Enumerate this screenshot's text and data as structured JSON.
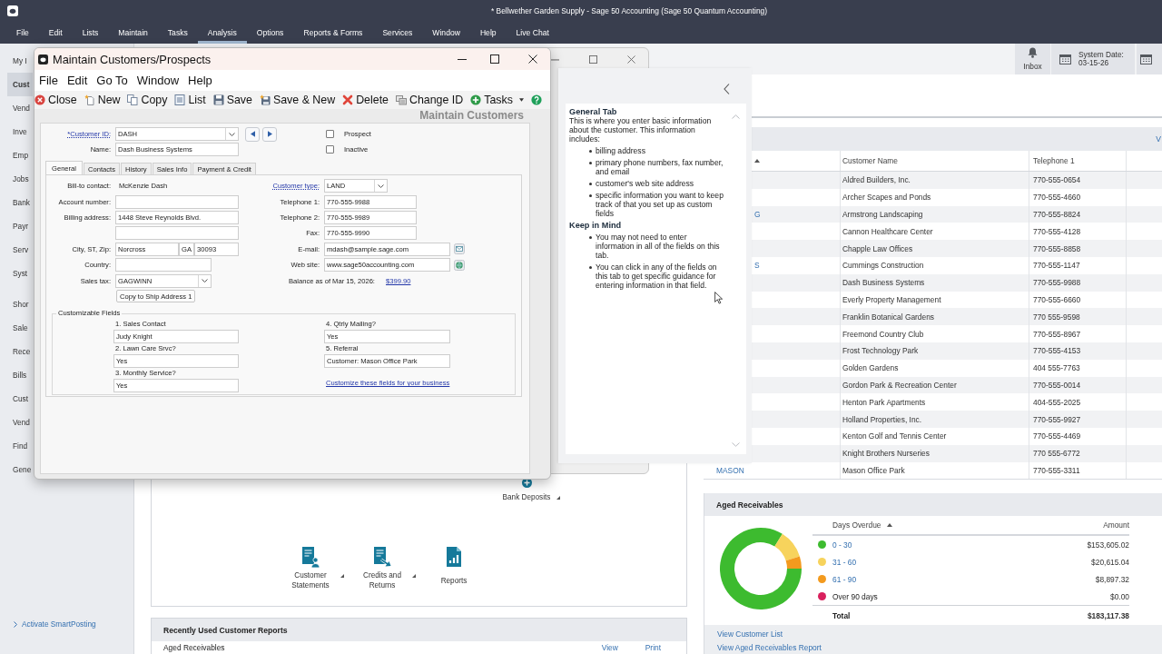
{
  "window": {
    "title": "* Bellwether Garden Supply - Sage 50 Accounting (Sage 50 Quantum Accounting)"
  },
  "menu": [
    {
      "label": "File",
      "selected": false
    },
    {
      "label": "Edit",
      "selected": false
    },
    {
      "label": "Lists",
      "selected": false
    },
    {
      "label": "Maintain",
      "selected": false
    },
    {
      "label": "Tasks",
      "selected": false
    },
    {
      "label": "Analysis",
      "selected": true
    },
    {
      "label": "Options",
      "selected": false
    },
    {
      "label": "Reports & Forms",
      "selected": false
    },
    {
      "label": "Services",
      "selected": false
    },
    {
      "label": "Window",
      "selected": false
    },
    {
      "label": "Help",
      "selected": false
    },
    {
      "label": "Live Chat",
      "selected": false
    }
  ],
  "sidebar": {
    "items": [
      {
        "label": "My I",
        "selected": false
      },
      {
        "label": "Cust",
        "selected": true
      },
      {
        "label": "Vend",
        "selected": false
      },
      {
        "label": "Inve",
        "selected": false
      },
      {
        "label": "Emp",
        "selected": false
      },
      {
        "label": "Jobs",
        "selected": false
      },
      {
        "label": "Bank",
        "selected": false
      },
      {
        "label": "Payr",
        "selected": false
      },
      {
        "label": "Serv",
        "selected": false
      },
      {
        "label": "Syst",
        "selected": false
      }
    ],
    "shortcuts_title": "Shor",
    "shortcuts": [
      "Sale",
      "Rece",
      "Bills",
      "Cust",
      "Vend",
      "Find",
      "Gene"
    ],
    "smartposting_link": "Activate SmartPosting"
  },
  "top_bar": {
    "inbox": "Inbox",
    "system_date_label": "System Date:",
    "system_date": "03-15-26"
  },
  "workflow": [
    {
      "kind": "deposit",
      "label": "Bank Deposits",
      "menu": true
    },
    {
      "kind": "statement",
      "label": "Customer Statements",
      "menu": true
    },
    {
      "kind": "credit",
      "label": "Credits and Returns",
      "menu": true
    },
    {
      "kind": "report",
      "label": "Reports",
      "menu": false
    }
  ],
  "recent_reports": {
    "title": "Recently Used Customer Reports",
    "rows": [
      {
        "name": "Aged Receivables",
        "actions": [
          "View",
          "Print"
        ]
      }
    ]
  },
  "customers": {
    "link": "V",
    "columns": [
      {
        "sorted": true,
        "cut": true
      },
      {
        "label": "Customer Name",
        "sorted": false
      },
      {
        "label": "Telephone 1",
        "sorted": false
      }
    ],
    "rows": [
      {
        "name": "Aldred Builders, Inc.",
        "phone": "770-555-0654"
      },
      {
        "name": "Archer Scapes and Ponds",
        "phone": "770-555-4660"
      },
      {
        "id": "G",
        "cut": true,
        "name": "Armstrong Landscaping",
        "phone": "770-555-8824"
      },
      {
        "name": "Cannon Healthcare Center",
        "phone": "770-555-4128"
      },
      {
        "name": "Chapple Law Offices",
        "phone": "770-555-8858"
      },
      {
        "id": "S",
        "cut": true,
        "name": "Cummings Construction",
        "phone": "770-555-1147"
      },
      {
        "name": "Dash Business Systems",
        "phone": "770-555-9988"
      },
      {
        "name": "Everly Property Management",
        "phone": "770-555-6660"
      },
      {
        "name": "Franklin Botanical Gardens",
        "phone": "770 555-9598"
      },
      {
        "name": "Freemond Country Club",
        "phone": "770-555-8967"
      },
      {
        "name": "Frost Technology Park",
        "phone": "770-555-4153"
      },
      {
        "name": "Golden Gardens",
        "phone": "404 555-7763"
      },
      {
        "name": "Gordon Park & Recreation Center",
        "phone": "770-555-0014"
      },
      {
        "name": "Henton Park Apartments",
        "phone": "404-555-2025"
      },
      {
        "name": "Holland Properties, Inc.",
        "phone": "770-555-9927"
      },
      {
        "name": "Kenton Golf and Tennis Center",
        "phone": "770-555-4469"
      },
      {
        "name": "Knight Brothers Nurseries",
        "phone": "770 555-6772"
      },
      {
        "id": "MASON",
        "name": "Mason Office Park",
        "phone": "770-555-3311"
      }
    ]
  },
  "aged_receivables": {
    "title": "Aged Receivables",
    "columns": [
      {
        "label": "Days Overdue",
        "sorted": true
      },
      {
        "label": "Amount",
        "sorted": false
      }
    ],
    "rows": [
      {
        "label": "0 - 30",
        "amount": "$153,605.02",
        "color": "#3dbb2f",
        "link": true
      },
      {
        "label": "31 - 60",
        "amount": "$20,615.04",
        "color": "#f7d35c",
        "link": true
      },
      {
        "label": "61 - 90",
        "amount": "$8,897.32",
        "color": "#f39a1e",
        "link": true
      },
      {
        "label": "Over 90 days",
        "amount": "$0.00",
        "color": "#d9205d",
        "link": false
      }
    ],
    "total": {
      "label": "Total",
      "amount": "$183,117.38"
    },
    "chart_data": {
      "type": "donut",
      "values": [
        83.88,
        11.26,
        4.86,
        0
      ]
    },
    "links": [
      "View Customer List",
      "View Aged Receivables Report"
    ]
  },
  "customer_dialog": {
    "title": "Maintain Customers/Prospects",
    "menu": [
      "File",
      "Edit",
      "Go To",
      "Window",
      "Help"
    ],
    "toolbar": [
      {
        "kind": "close",
        "label": "Close"
      },
      {
        "kind": "new",
        "label": "New"
      },
      {
        "kind": "copy",
        "label": "Copy"
      },
      {
        "kind": "list",
        "label": "List"
      },
      {
        "kind": "save",
        "label": "Save"
      },
      {
        "kind": "save-new",
        "label": "Save & New"
      },
      {
        "kind": "delete",
        "label": "Delete"
      },
      {
        "kind": "change-id",
        "label": "Change ID"
      },
      {
        "kind": "tasks",
        "label": "Tasks",
        "menu": true
      },
      {
        "kind": "help"
      }
    ],
    "heading": "Maintain Customers",
    "customer_id": {
      "label": "*Customer ID:",
      "link": true,
      "value": "DASH"
    },
    "name": {
      "label": "Name:",
      "value": "Dash Business Systems"
    },
    "checkboxes": [
      {
        "label": "Prospect",
        "checked": false
      },
      {
        "label": "Inactive",
        "checked": false
      }
    ],
    "tabs": [
      {
        "label": "General",
        "selected": true
      },
      {
        "label": "Contacts",
        "selected": false
      },
      {
        "label": "History",
        "selected": false
      },
      {
        "label": "Sales Info",
        "selected": false
      },
      {
        "label": "Payment & Credit",
        "selected": false
      }
    ],
    "general": {
      "left": [
        {
          "kind": "text",
          "label": "Bill-to contact:",
          "value": "McKenzie Dash"
        },
        {
          "kind": "input",
          "label": "Account number:"
        },
        {
          "kind": "input",
          "label": "Billing address:",
          "value": "1448 Steve Reynolds Blvd."
        },
        {
          "kind": "input"
        },
        {
          "kind": "city",
          "label": "City, ST, Zip:",
          "values": [
            "Norcross",
            "GA",
            "30093"
          ]
        },
        {
          "kind": "input",
          "label": "Country:",
          "narrow": true
        },
        {
          "kind": "dropdown",
          "label": "Sales tax:",
          "value": "GAGWINN",
          "narrow": true
        },
        {
          "kind": "button",
          "value": "Copy to Ship Address 1"
        }
      ],
      "right": [
        {
          "kind": "dropdown",
          "label": "Customer type:",
          "link": true,
          "value": "LAND",
          "narrow": true
        },
        {
          "kind": "input",
          "label": "Telephone 1:",
          "value": "770-555-9988"
        },
        {
          "kind": "input",
          "label": "Telephone 2:",
          "value": "770-555-9989"
        },
        {
          "kind": "input",
          "label": "Fax:",
          "value": "770-555-9990"
        },
        {
          "kind": "email",
          "label": "E-mail:",
          "value": "mdash@sample.sage.com"
        },
        {
          "kind": "web",
          "label": "Web site:",
          "value": "www.sage50accounting.com"
        },
        {
          "kind": "balance",
          "label": "Balance as of Mar 15, 2026:",
          "value": "$399.90"
        }
      ]
    },
    "custom_fields": {
      "title": "Customizable Fields",
      "items": [
        {
          "label": "1. Sales Contact",
          "value": "Judy Knight"
        },
        {
          "label": "2. Lawn Care Srvc?",
          "value": "Yes"
        },
        {
          "label": "3. Monthly Service?",
          "value": "Yes"
        },
        {
          "label": "4. Qtrly Mailing?",
          "value": "Yes"
        },
        {
          "label": "5. Referral",
          "value": "Customer: Mason Office Park"
        }
      ],
      "link": "Customize these fields for your business"
    }
  },
  "help_panel": {
    "sections": [
      {
        "heading": "General Tab",
        "text": "This is where you enter basic information about the customer. This information includes:",
        "bullets": [
          "billing address",
          "primary phone numbers, fax number, and email",
          "customer's web site address",
          "specific information you want to keep track of that you set up as custom fields"
        ]
      },
      {
        "heading": "Keep in Mind",
        "bullets": [
          "You may not need to enter information in all of the fields on this tab.",
          "You can click in any of the fields on this tab to get specific guidance for entering information in that field."
        ]
      }
    ]
  }
}
